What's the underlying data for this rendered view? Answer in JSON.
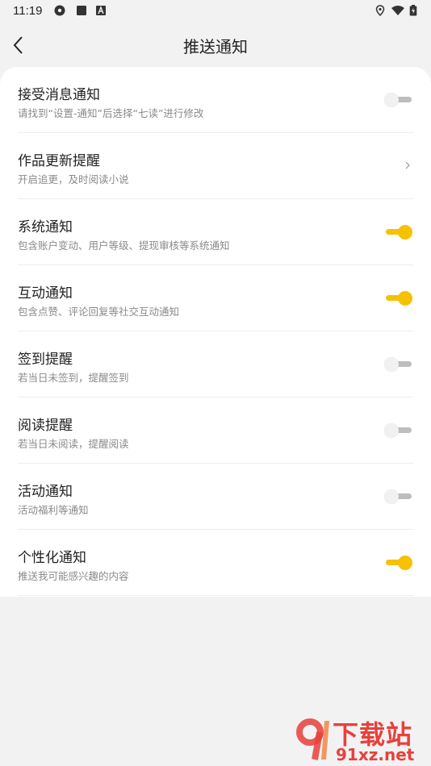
{
  "status_bar": {
    "time": "11:19",
    "icons": [
      "settings-gear-icon",
      "stop-square-icon",
      "a-box-icon",
      "location-icon",
      "wifi-icon",
      "battery-icon"
    ]
  },
  "header": {
    "title": "推送通知",
    "back_icon": "chevron-left-icon"
  },
  "settings": [
    {
      "title": "接受消息通知",
      "desc": "请找到“设置-通知”后选择“七读”进行修改",
      "control": "toggle",
      "on": false
    },
    {
      "title": "作品更新提醒",
      "desc": "开启追更，及时阅读小说",
      "control": "chevron"
    },
    {
      "title": "系统通知",
      "desc": "包含账户变动、用户等级、提现审核等系统通知",
      "control": "toggle",
      "on": true
    },
    {
      "title": "互动通知",
      "desc": "包含点赞、评论回复等社交互动通知",
      "control": "toggle",
      "on": true
    },
    {
      "title": "签到提醒",
      "desc": "若当日未签到，提醒签到",
      "control": "toggle",
      "on": false
    },
    {
      "title": "阅读提醒",
      "desc": "若当日未阅读，提醒阅读",
      "control": "toggle",
      "on": false
    },
    {
      "title": "活动通知",
      "desc": "活动福利等通知",
      "control": "toggle",
      "on": false
    },
    {
      "title": "个性化通知",
      "desc": "推送我可能感兴趣的内容",
      "control": "toggle",
      "on": true
    }
  ],
  "colors": {
    "accent": "#f6c100",
    "toggle_off": "#bdbdbd",
    "background": "#f2f2f2"
  },
  "watermark": {
    "line1": "下载站",
    "line2": "91xz.net"
  }
}
